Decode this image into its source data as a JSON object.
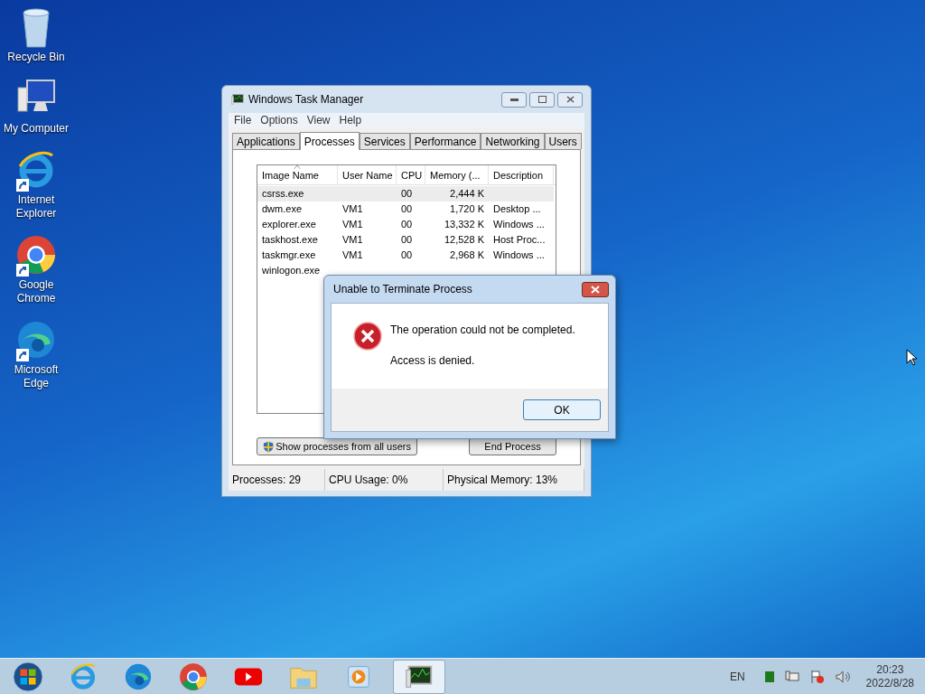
{
  "desktop_icons": [
    {
      "kind": "recycle",
      "label": "Recycle Bin",
      "shortcut": false
    },
    {
      "kind": "computer",
      "label": "My Computer",
      "shortcut": false
    },
    {
      "kind": "ie",
      "label": "Internet Explorer",
      "shortcut": true
    },
    {
      "kind": "chrome",
      "label": "Google Chrome",
      "shortcut": true
    },
    {
      "kind": "edge",
      "label": "Microsoft Edge",
      "shortcut": true
    }
  ],
  "task_manager": {
    "title": "Windows Task Manager",
    "menu": [
      "File",
      "Options",
      "View",
      "Help"
    ],
    "tabs": [
      {
        "label": "Applications",
        "selected": false
      },
      {
        "label": "Processes",
        "selected": true
      },
      {
        "label": "Services",
        "selected": false
      },
      {
        "label": "Performance",
        "selected": false
      },
      {
        "label": "Networking",
        "selected": false
      },
      {
        "label": "Users",
        "selected": false
      }
    ],
    "table": {
      "columns": [
        {
          "label": "Image Name",
          "sorted": true
        },
        {
          "label": "User Name",
          "sorted": false
        },
        {
          "label": "CPU",
          "sorted": false
        },
        {
          "label": "Memory (...",
          "sorted": false
        },
        {
          "label": "Description",
          "sorted": false
        }
      ],
      "rows": [
        {
          "selected": true,
          "cells": [
            "csrss.exe",
            "",
            "00",
            "2,444 K",
            ""
          ]
        },
        {
          "selected": false,
          "cells": [
            "dwm.exe",
            "VM1",
            "00",
            "1,720 K",
            "Desktop ..."
          ]
        },
        {
          "selected": false,
          "cells": [
            "explorer.exe",
            "VM1",
            "00",
            "13,332 K",
            "Windows ..."
          ]
        },
        {
          "selected": false,
          "cells": [
            "taskhost.exe",
            "VM1",
            "00",
            "12,528 K",
            "Host Proc..."
          ]
        },
        {
          "selected": false,
          "cells": [
            "taskmgr.exe",
            "VM1",
            "00",
            "2,968 K",
            "Windows ..."
          ]
        },
        {
          "selected": false,
          "cells": [
            "winlogon.exe",
            "",
            "",
            "",
            ""
          ]
        }
      ]
    },
    "show_all_button": "Show processes from all users",
    "end_button": "End Process",
    "status_bar": [
      "Processes: 29",
      "CPU Usage: 0%",
      "Physical Memory: 13%"
    ]
  },
  "dialog": {
    "title": "Unable to Terminate Process",
    "message": "The operation could not be completed.",
    "detail": "Access is denied.",
    "ok": "OK"
  },
  "taskbar": {
    "items": [
      {
        "kind": "start",
        "selected": false
      },
      {
        "kind": "ie",
        "selected": false
      },
      {
        "kind": "edge",
        "selected": false
      },
      {
        "kind": "chrome",
        "selected": false
      },
      {
        "kind": "youtube",
        "selected": false
      },
      {
        "kind": "folder",
        "selected": false
      },
      {
        "kind": "media",
        "selected": false
      },
      {
        "kind": "taskmgr",
        "selected": true
      }
    ],
    "language": "EN",
    "time": "20:23",
    "date": "2022/8/28"
  }
}
